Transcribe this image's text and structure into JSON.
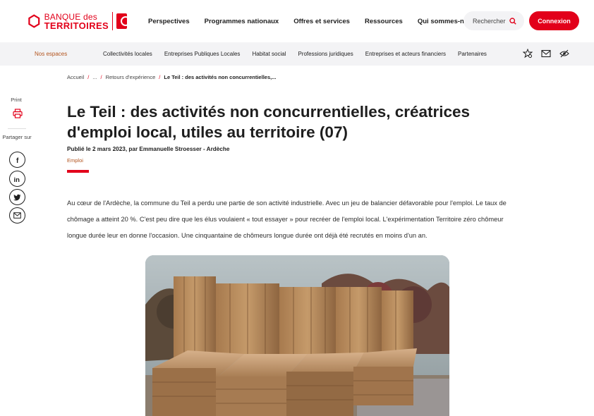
{
  "header": {
    "logo": {
      "line1": "BANQUE des",
      "line2": "TERRITOIRES"
    },
    "nav": [
      "Perspectives",
      "Programmes nationaux",
      "Offres et services",
      "Ressources",
      "Qui sommes-nous ?"
    ],
    "search_label": "Rechercher",
    "login_label": "Connexion"
  },
  "subnav": {
    "spaces_label": "Nos espaces",
    "links": [
      "Collectivités locales",
      "Entreprises Publiques Locales",
      "Habitat social",
      "Professions juridiques",
      "Entreprises et acteurs financiers",
      "Partenaires"
    ],
    "tool_icons": [
      "star-location-icon",
      "mail-icon",
      "visibility-off-icon"
    ]
  },
  "breadcrumb": {
    "home": "Accueil",
    "ellipsis": "...",
    "parent": "Retours d'expérience",
    "current": "Le Teil : des activités non concurrentielles,..."
  },
  "share": {
    "print_label": "Print",
    "share_label": "Partager sur",
    "icons": [
      "facebook-icon",
      "linkedin-icon",
      "twitter-icon",
      "email-icon"
    ]
  },
  "article": {
    "title": "Le Teil : des activités non concurrentielles, créatrices d'emploi local, utiles au territoire (07)",
    "byline": "Publié le 2 mars 2023, par Emmanuelle Stroesser - Ardèche",
    "tag": "Emploi",
    "intro": "Au cœur de l'Ardèche, la commune du Teil a perdu une partie de son activité industrielle. Avec un jeu de balancier défavorable pour l'emploi. Le taux de chômage a atteint 20 %. C'est peu dire que les élus voulaient « tout essayer » pour recréer de l'emploi local. L'expérimentation Territoire zéro chômeur longue durée leur en donne l'occasion. Une cinquantaine de chômeurs longue durée ont déjà été recrutés en moins d'un an."
  },
  "colors": {
    "brand": "#e2001a",
    "accent_text": "#b3541e",
    "subnav_bg": "#f3f3f5"
  }
}
